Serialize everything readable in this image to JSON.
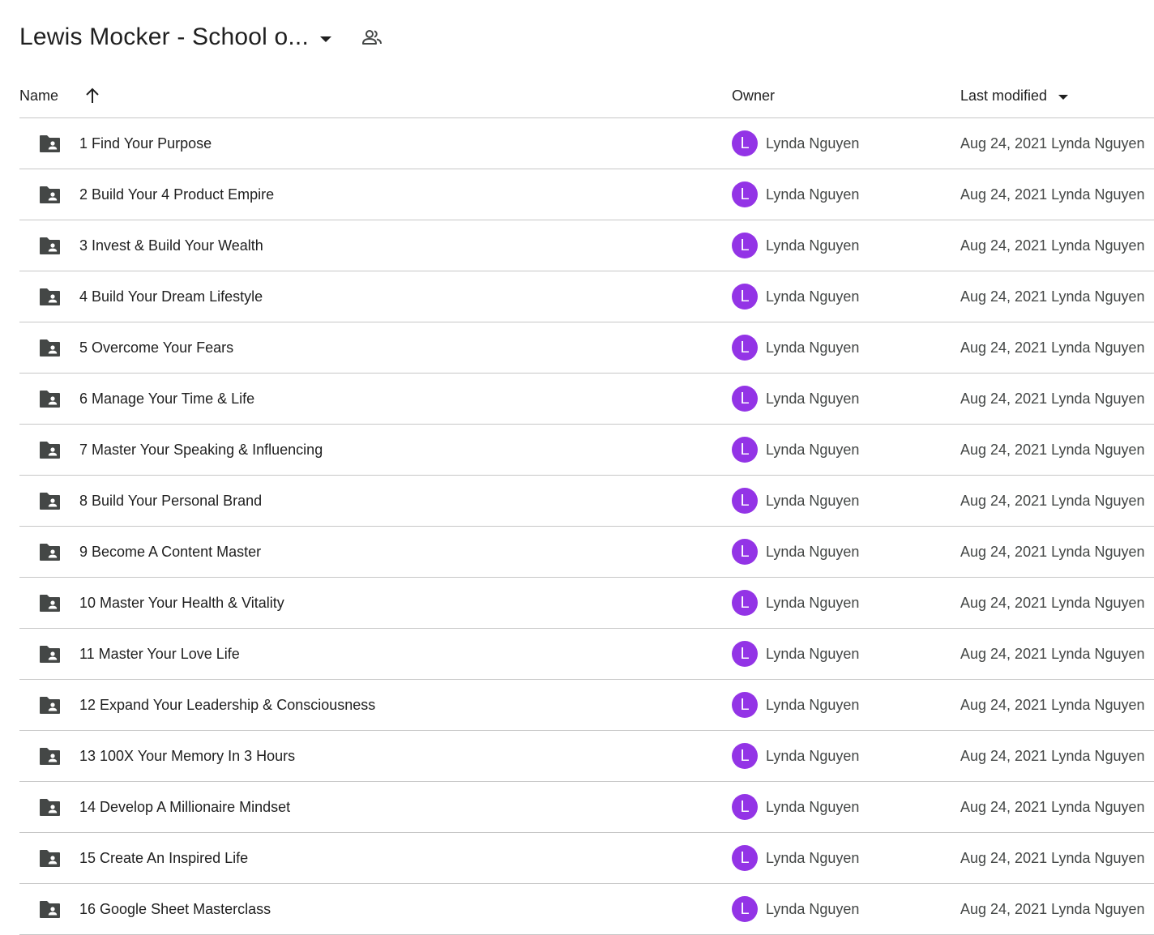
{
  "header": {
    "title": "Lewis Mocker - School o...",
    "title_icon": "chevron-down-icon",
    "shared_icon": "people-icon"
  },
  "columns": {
    "name": "Name",
    "owner": "Owner",
    "last_modified": "Last modified"
  },
  "colors": {
    "avatar": "#9334e6",
    "folder_icon": "#444746",
    "divider": "#c7c7c7"
  },
  "files": [
    {
      "name": "1 Find Your Purpose",
      "owner_initial": "L",
      "owner": "Lynda Nguyen",
      "modified": "Aug 24, 2021 Lynda Nguyen"
    },
    {
      "name": "2 Build Your 4 Product Empire",
      "owner_initial": "L",
      "owner": "Lynda Nguyen",
      "modified": "Aug 24, 2021 Lynda Nguyen"
    },
    {
      "name": "3 Invest & Build Your Wealth",
      "owner_initial": "L",
      "owner": "Lynda Nguyen",
      "modified": "Aug 24, 2021 Lynda Nguyen"
    },
    {
      "name": "4 Build Your Dream Lifestyle",
      "owner_initial": "L",
      "owner": "Lynda Nguyen",
      "modified": "Aug 24, 2021 Lynda Nguyen"
    },
    {
      "name": "5 Overcome Your Fears",
      "owner_initial": "L",
      "owner": "Lynda Nguyen",
      "modified": "Aug 24, 2021 Lynda Nguyen"
    },
    {
      "name": "6 Manage Your Time & Life",
      "owner_initial": "L",
      "owner": "Lynda Nguyen",
      "modified": "Aug 24, 2021 Lynda Nguyen"
    },
    {
      "name": "7 Master Your Speaking & Influencing",
      "owner_initial": "L",
      "owner": "Lynda Nguyen",
      "modified": "Aug 24, 2021 Lynda Nguyen"
    },
    {
      "name": "8 Build Your Personal Brand",
      "owner_initial": "L",
      "owner": "Lynda Nguyen",
      "modified": "Aug 24, 2021 Lynda Nguyen"
    },
    {
      "name": "9 Become A Content Master",
      "owner_initial": "L",
      "owner": "Lynda Nguyen",
      "modified": "Aug 24, 2021 Lynda Nguyen"
    },
    {
      "name": "10 Master Your Health & Vitality",
      "owner_initial": "L",
      "owner": "Lynda Nguyen",
      "modified": "Aug 24, 2021 Lynda Nguyen"
    },
    {
      "name": "11 Master Your Love Life",
      "owner_initial": "L",
      "owner": "Lynda Nguyen",
      "modified": "Aug 24, 2021 Lynda Nguyen"
    },
    {
      "name": "12 Expand Your Leadership & Consciousness",
      "owner_initial": "L",
      "owner": "Lynda Nguyen",
      "modified": "Aug 24, 2021 Lynda Nguyen"
    },
    {
      "name": "13 100X Your Memory In 3 Hours",
      "owner_initial": "L",
      "owner": "Lynda Nguyen",
      "modified": "Aug 24, 2021 Lynda Nguyen"
    },
    {
      "name": "14 Develop A Millionaire Mindset",
      "owner_initial": "L",
      "owner": "Lynda Nguyen",
      "modified": "Aug 24, 2021 Lynda Nguyen"
    },
    {
      "name": "15 Create An Inspired Life",
      "owner_initial": "L",
      "owner": "Lynda Nguyen",
      "modified": "Aug 24, 2021 Lynda Nguyen"
    },
    {
      "name": "16 Google Sheet Masterclass",
      "owner_initial": "L",
      "owner": "Lynda Nguyen",
      "modified": "Aug 24, 2021 Lynda Nguyen"
    }
  ]
}
